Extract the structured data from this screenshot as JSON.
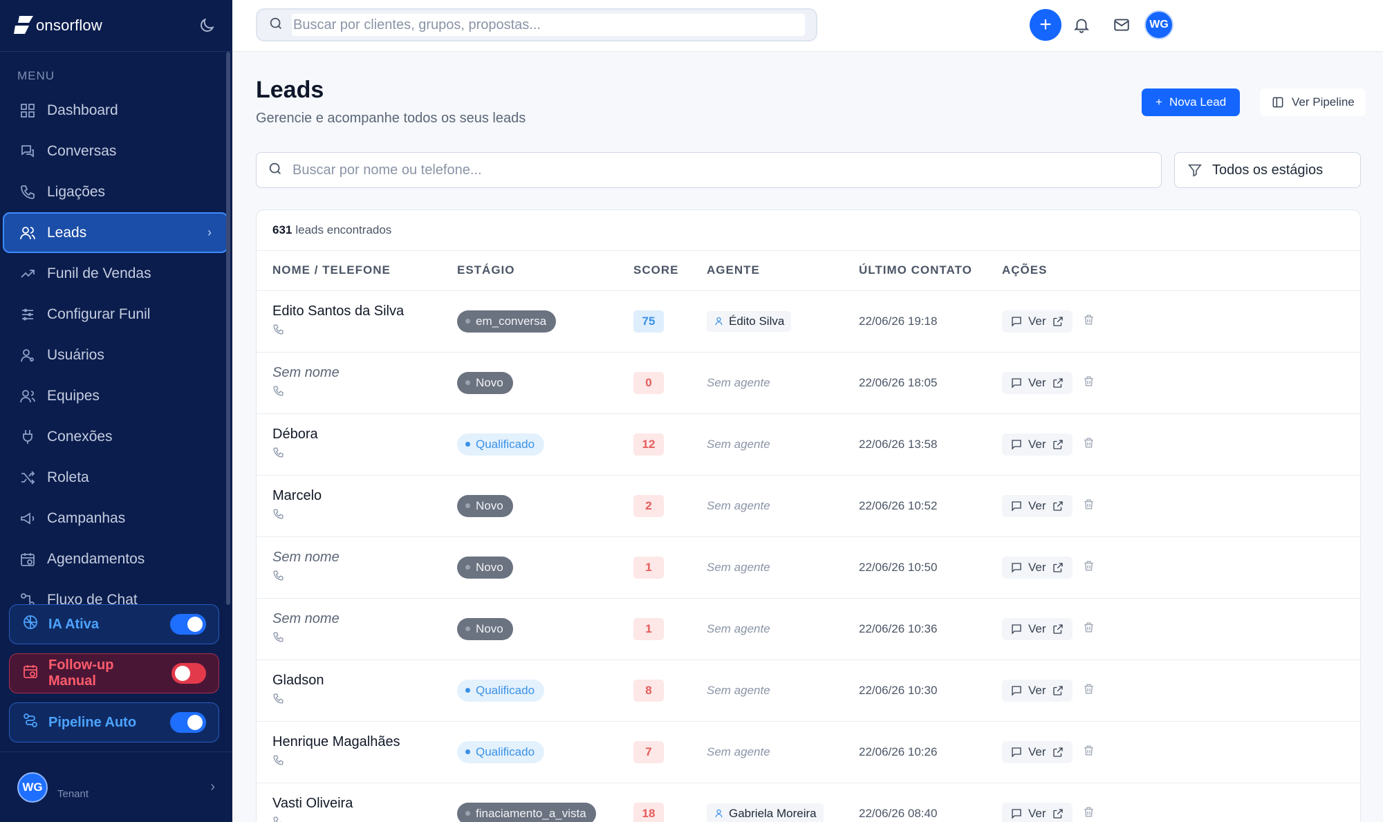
{
  "brand": {
    "name": "onsorflow"
  },
  "sidebar": {
    "menu_label": "MENU",
    "items": [
      {
        "label": "Dashboard",
        "icon": "dashboard-icon"
      },
      {
        "label": "Conversas",
        "icon": "chat-icon"
      },
      {
        "label": "Ligações",
        "icon": "phone-icon"
      },
      {
        "label": "Leads",
        "icon": "users-icon",
        "active": true
      },
      {
        "label": "Funil de Vendas",
        "icon": "trending-icon"
      },
      {
        "label": "Configurar Funil",
        "icon": "sliders-icon"
      },
      {
        "label": "Usuários",
        "icon": "user-icon"
      },
      {
        "label": "Equipes",
        "icon": "team-icon"
      },
      {
        "label": "Conexões",
        "icon": "plug-icon"
      },
      {
        "label": "Roleta",
        "icon": "shuffle-icon"
      },
      {
        "label": "Campanhas",
        "icon": "megaphone-icon"
      },
      {
        "label": "Agendamentos",
        "icon": "calendar-icon"
      },
      {
        "label": "Fluxo de Chat",
        "icon": "flow-icon"
      }
    ],
    "toggles": [
      {
        "label": "IA Ativa",
        "on": true
      },
      {
        "label": "Follow-up Manual",
        "on": false
      },
      {
        "label": "Pipeline Auto",
        "on": true
      }
    ],
    "footer": {
      "initials": "WG",
      "tenant": "Tenant"
    }
  },
  "topbar": {
    "search_placeholder": "Buscar por clientes, grupos, propostas...",
    "avatar_initials": "WG"
  },
  "page": {
    "title": "Leads",
    "subtitle": "Gerencie e acompanhe todos os seus leads",
    "new_lead_label": "Nova Lead",
    "pipeline_label": "Ver Pipeline",
    "search_placeholder": "Buscar por nome ou telefone...",
    "stage_filter": "Todos os estágios"
  },
  "table": {
    "count": "631",
    "count_suffix": "leads encontrados",
    "columns": [
      "NOME / TELEFONE",
      "ESTÁGIO",
      "SCORE",
      "AGENTE",
      "ÚLTIMO CONTATO",
      "AÇÕES"
    ],
    "view_label": "Ver",
    "rows": [
      {
        "name": "Edito Santos da Silva",
        "unnamed": false,
        "stage": "em_conversa",
        "stage_style": "gray",
        "score": "75",
        "score_style": "blue",
        "agent": "Édito Silva",
        "date": "22/06/26 19:18"
      },
      {
        "name": "Sem nome",
        "unnamed": true,
        "stage": "Novo",
        "stage_style": "gray",
        "score": "0",
        "score_style": "red",
        "agent": null,
        "date": "22/06/26 18:05"
      },
      {
        "name": "Débora",
        "unnamed": false,
        "stage": "Qualificado",
        "stage_style": "blue",
        "score": "12",
        "score_style": "red",
        "agent": null,
        "date": "22/06/26 13:58"
      },
      {
        "name": "Marcelo",
        "unnamed": false,
        "stage": "Novo",
        "stage_style": "gray",
        "score": "2",
        "score_style": "red",
        "agent": null,
        "date": "22/06/26 10:52"
      },
      {
        "name": "Sem nome",
        "unnamed": true,
        "stage": "Novo",
        "stage_style": "gray",
        "score": "1",
        "score_style": "red",
        "agent": null,
        "date": "22/06/26 10:50"
      },
      {
        "name": "Sem nome",
        "unnamed": true,
        "stage": "Novo",
        "stage_style": "gray",
        "score": "1",
        "score_style": "red",
        "agent": null,
        "date": "22/06/26 10:36"
      },
      {
        "name": "Gladson",
        "unnamed": false,
        "stage": "Qualificado",
        "stage_style": "blue",
        "score": "8",
        "score_style": "red",
        "agent": null,
        "date": "22/06/26 10:30"
      },
      {
        "name": "Henrique Magalhães",
        "unnamed": false,
        "stage": "Qualificado",
        "stage_style": "blue",
        "score": "7",
        "score_style": "red",
        "agent": null,
        "date": "22/06/26 10:26"
      },
      {
        "name": "Vasti Oliveira",
        "unnamed": false,
        "stage": "finaciamento_a_vista",
        "stage_style": "gray",
        "score": "18",
        "score_style": "red",
        "agent": "Gabriela Moreira",
        "date": "22/06/26 08:40"
      }
    ],
    "no_agent_label": "Sem agente"
  },
  "colors": {
    "sidebar_bg": "#0b1d4d",
    "accent": "#1466ff",
    "active_item": "#1b4ea8"
  }
}
